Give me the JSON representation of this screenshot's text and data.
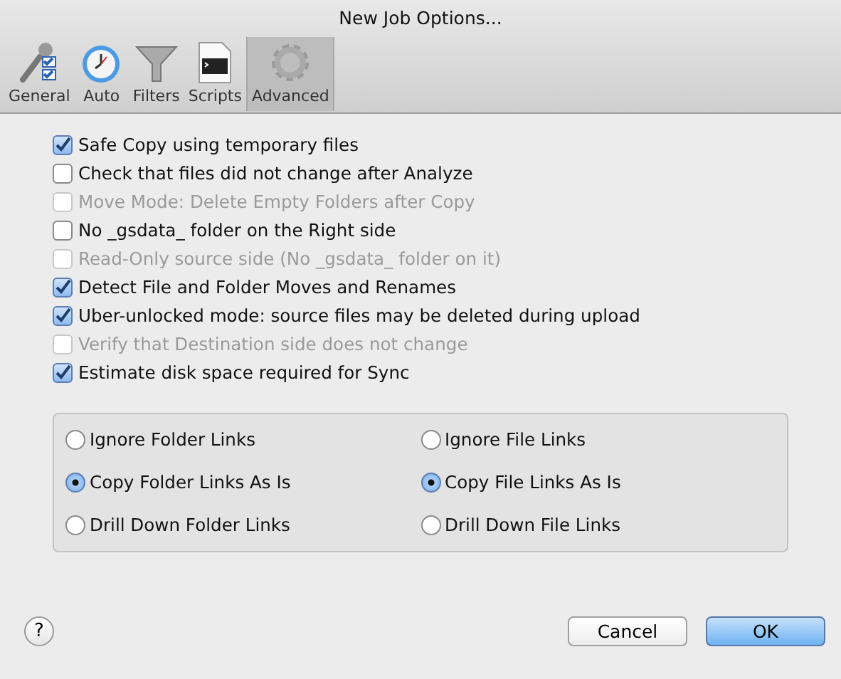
{
  "window": {
    "title": "New Job Options..."
  },
  "tabs": [
    {
      "label": "General",
      "kind": "general",
      "selected": false
    },
    {
      "label": "Auto",
      "kind": "auto",
      "selected": false
    },
    {
      "label": "Filters",
      "kind": "filters",
      "selected": false
    },
    {
      "label": "Scripts",
      "kind": "scripts",
      "selected": false
    },
    {
      "label": "Advanced",
      "kind": "advanced",
      "selected": true
    }
  ],
  "options": [
    {
      "label": "Safe Copy using temporary files",
      "checked": true,
      "disabled": false
    },
    {
      "label": "Check that files did not change after Analyze",
      "checked": false,
      "disabled": false
    },
    {
      "label": "Move Mode: Delete Empty Folders after Copy",
      "checked": false,
      "disabled": true
    },
    {
      "label": "No _gsdata_ folder on the Right side",
      "checked": false,
      "disabled": false
    },
    {
      "label": "Read-Only source side (No _gsdata_ folder on it)",
      "checked": false,
      "disabled": true
    },
    {
      "label": "Detect File and Folder Moves and Renames",
      "checked": true,
      "disabled": false
    },
    {
      "label": "Uber-unlocked mode: source files may be deleted during upload",
      "checked": true,
      "disabled": false
    },
    {
      "label": "Verify that Destination side does not change",
      "checked": false,
      "disabled": true
    },
    {
      "label": "Estimate disk space required for Sync",
      "checked": true,
      "disabled": false
    }
  ],
  "link_groups": [
    {
      "options": [
        {
          "label": "Ignore Folder Links",
          "selected": false
        },
        {
          "label": "Copy Folder Links As Is",
          "selected": true
        },
        {
          "label": "Drill Down Folder Links",
          "selected": false
        }
      ]
    },
    {
      "options": [
        {
          "label": "Ignore File Links",
          "selected": false
        },
        {
          "label": "Copy File Links As Is",
          "selected": true
        },
        {
          "label": "Drill Down File Links",
          "selected": false
        }
      ]
    }
  ],
  "help": {
    "label": "?"
  },
  "buttons": [
    {
      "label": "Cancel",
      "kind": "normal"
    },
    {
      "label": "OK",
      "kind": "default"
    }
  ]
}
